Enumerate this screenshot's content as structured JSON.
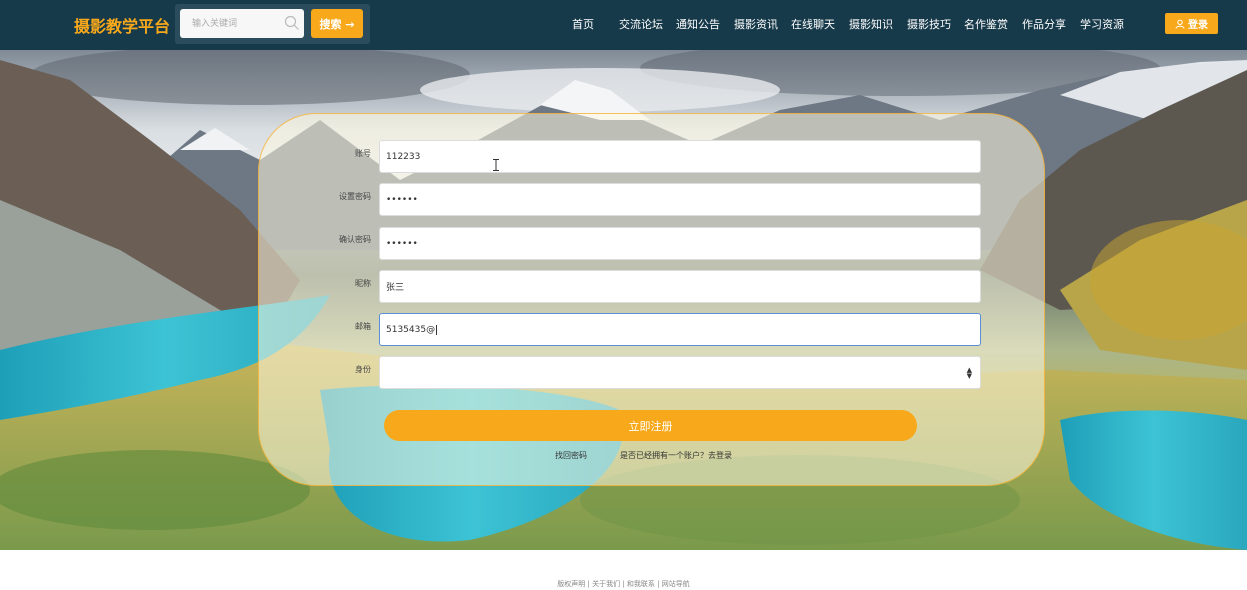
{
  "header": {
    "logo": "摄影教学平台",
    "search": {
      "placeholder": "输入关键词",
      "button_label": "搜索 →"
    },
    "nav": [
      "首页",
      "交流论坛",
      "通知公告",
      "摄影资讯",
      "在线聊天",
      "摄影知识",
      "摄影技巧",
      "名作鉴赏",
      "作品分享",
      "学习资源"
    ],
    "login_label": "登录"
  },
  "form": {
    "labels": {
      "account": "账号",
      "password": "设置密码",
      "confirm": "确认密码",
      "nickname": "昵称",
      "email": "邮箱",
      "role": "身份"
    },
    "values": {
      "account": "112233",
      "password": "••••••",
      "confirm": "••••••",
      "nickname": "张三",
      "email": "5135435@",
      "role": ""
    },
    "submit_label": "立即注册",
    "links": {
      "forgot": "找回密码",
      "have_account": "是否已经拥有一个账户？去登录"
    }
  },
  "footer": {
    "text": "版权声明 | 关于我们 | 和我联系 | 网站导航"
  },
  "colors": {
    "accent": "#f7a81b",
    "header_bg": "#173a4a"
  }
}
